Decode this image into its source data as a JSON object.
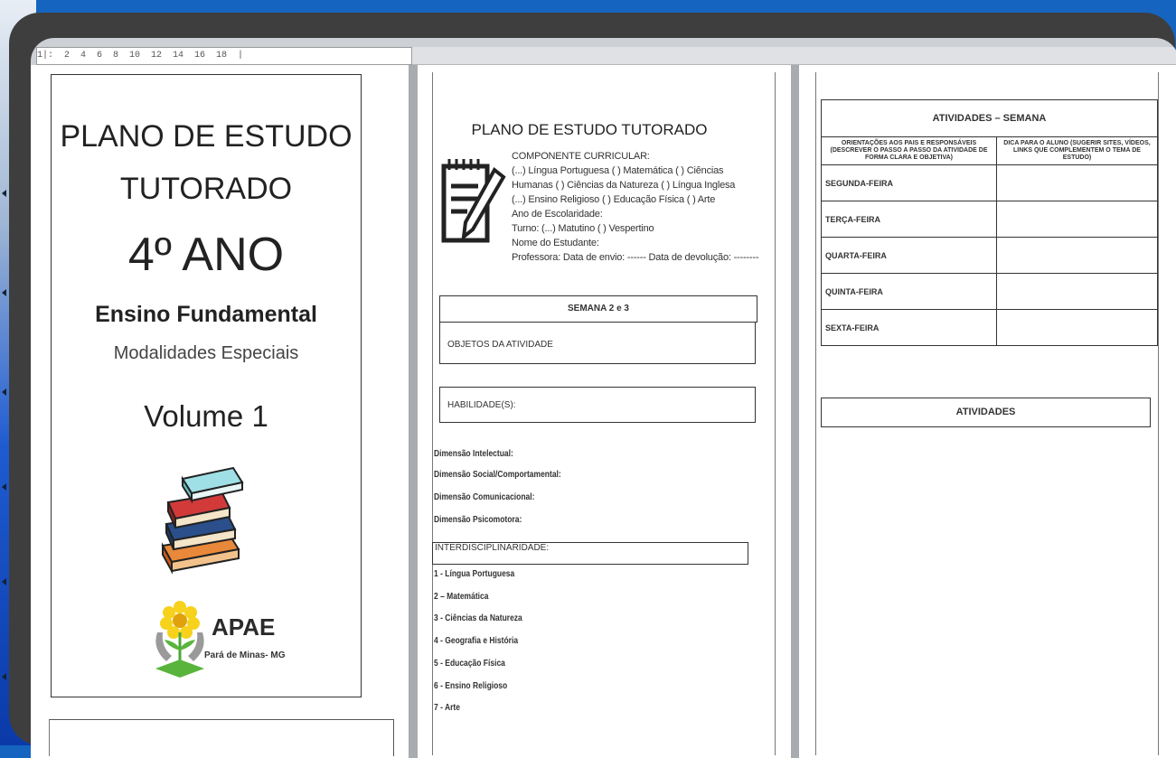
{
  "ruler": {
    "text": "1|:  2  4  6  8  10  12  14  16  18  |"
  },
  "cover": {
    "title_line1": "PLANO DE ESTUDO",
    "title_line2": "TUTORADO",
    "grade": "4º ANO",
    "level": "Ensino Fundamental",
    "modality": "Modalidades Especiais",
    "volume": "Volume 1",
    "logo_name": "APAE",
    "logo_city": "Pará de Minas- MG"
  },
  "plan": {
    "title": "PLANO DE ESTUDO TUTORADO",
    "lines": [
      "COMPONENTE CURRICULAR:",
      "(...) Língua  Portuguesa   (   ) Matemática  (   ) Ciências",
      "Humanas  (   ) Ciências da Natureza (   ) Língua Inglesa",
      "(...) Ensino Religioso (   ) Educação Física (   ) Arte",
      "Ano de Escolaridade:",
      "Turno: (...) Matutino   (   ) Vespertino",
      " Nome do Estudante:",
      "Professora: Data de envio: ------ Data de devolução: --------"
    ],
    "week_label": "SEMANA 2 e 3",
    "objects_label": "OBJETOS DA ATIVIDADE",
    "skills_label": "HABILIDADE(S):",
    "dimensions": [
      "Dimensão Intelectual:",
      "Dimensão Social/Comportamental:",
      "Dimensão Comunicacional:",
      "Dimensão Psicomotora:"
    ],
    "interdisc_label": "INTERDISCIPLINARIDADE:",
    "subjects": [
      "1 - Língua Portuguesa",
      "2 – Matemática",
      "3 - Ciências da Natureza",
      "4 - Geografia e História",
      "5 - Educação Física",
      "6 - Ensino Religioso",
      "7 - Arte"
    ]
  },
  "activities": {
    "week_title": "ATIVIDADES – SEMANA",
    "col1_header": "ORIENTAÇÕES AOS PAIS E RESPONSÁVEIS (DESCREVER O PASSO A PASSO DA ATIVIDADE DE FORMA CLARA E OBJETIVA)",
    "col2_header": "DICA PARA O ALUNO (SUGERIR SITES, VÍDEOS, LINKS QUE COMPLEMENTEM O TEMA DE ESTUDO)",
    "days": [
      "SEGUNDA-FEIRA",
      "TERÇA-FEIRA",
      "QUARTA-FEIRA",
      "QUINTA-FEIRA",
      "SEXTA-FEIRA"
    ],
    "activities_label": "ATIVIDADES"
  },
  "icons": {
    "notebook": "notebook-pencil-icon",
    "books": "books-stack-icon",
    "logo": "apae-flower-logo"
  }
}
